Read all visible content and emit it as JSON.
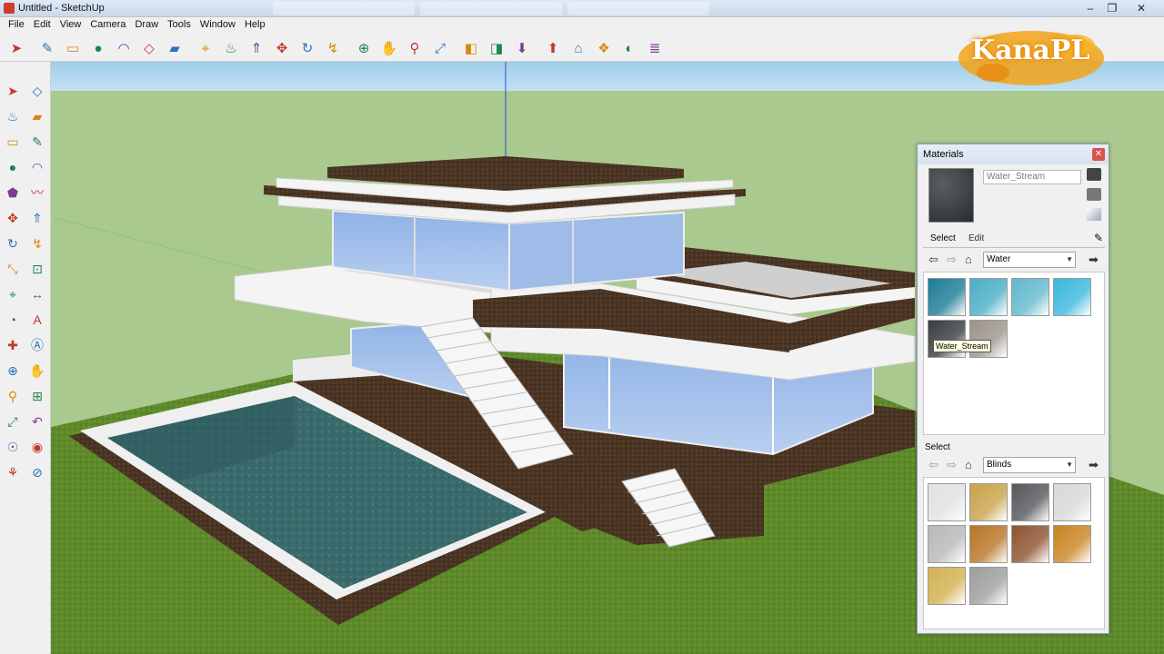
{
  "window": {
    "title": "Untitled - SketchUp"
  },
  "menu": [
    "File",
    "Edit",
    "View",
    "Camera",
    "Draw",
    "Tools",
    "Window",
    "Help"
  ],
  "toolbar_icons": [
    "select-icon",
    "pencil-icon",
    "rectangle-icon",
    "circle-icon",
    "arc-icon",
    "make-component-icon",
    "eraser-icon",
    "tape-measure-icon",
    "paint-bucket-icon",
    "push-pull-icon",
    "move-icon",
    "rotate-icon",
    "follow-me-icon",
    "orbit-icon",
    "pan-icon",
    "zoom-icon",
    "zoom-extents-icon",
    "previous-view-icon",
    "next-view-icon",
    "get-models-icon",
    "share-model-icon",
    "warehouse-icon",
    "components-icon",
    "styles-icon",
    "layers-icon"
  ],
  "left_tool_icons": [
    [
      "select-icon",
      "make-component-icon"
    ],
    [
      "paint-bucket-icon",
      "eraser-icon"
    ],
    [
      "rectangle-icon",
      "pencil-icon"
    ],
    [
      "circle-icon",
      "arc-icon"
    ],
    [
      "polygon-icon",
      "freehand-icon"
    ],
    [
      "move-icon",
      "push-pull-icon"
    ],
    [
      "rotate-icon",
      "follow-me-icon"
    ],
    [
      "scale-icon",
      "offset-icon"
    ],
    [
      "tape-measure-icon",
      "dimension-icon"
    ],
    [
      "protractor-icon",
      "text-icon"
    ],
    [
      "axes-icon",
      "3d-text-icon"
    ],
    [
      "orbit-icon",
      "pan-icon"
    ],
    [
      "zoom-icon",
      "zoom-window-icon"
    ],
    [
      "zoom-extents-icon",
      "previous-icon"
    ],
    [
      "position-camera-icon",
      "look-around-icon"
    ],
    [
      "walk-icon",
      "section-plane-icon"
    ]
  ],
  "logo": {
    "text": "KanaPL"
  },
  "materials": {
    "title": "Materials",
    "current_material": "Water_Stream",
    "tabs": {
      "select": "Select",
      "edit": "Edit"
    },
    "top_library": "Water",
    "top_swatches": [
      {
        "name": "water-deep-blue",
        "color": "#1c7c98"
      },
      {
        "name": "water-ripple",
        "color": "#4aaec6"
      },
      {
        "name": "water-light",
        "color": "#62b8cc"
      },
      {
        "name": "water-bright",
        "color": "#3bb8dc"
      },
      {
        "name": "water-stream",
        "color": "#3a3d40"
      },
      {
        "name": "water-sand",
        "color": "#9c948a"
      }
    ],
    "tooltip": "Water_Stream",
    "bottom_label": "Select",
    "bottom_library": "Blinds",
    "bottom_swatches": [
      {
        "name": "blind-white",
        "color": "#e2e2e2"
      },
      {
        "name": "blind-gold",
        "color": "#c9a24a"
      },
      {
        "name": "blind-dark-gray",
        "color": "#55575a"
      },
      {
        "name": "blind-light-gray",
        "color": "#d8d8d8"
      },
      {
        "name": "blind-silver",
        "color": "#b8b8b8"
      },
      {
        "name": "blind-wood-orange",
        "color": "#b87424"
      },
      {
        "name": "blind-wood-red",
        "color": "#8e5330"
      },
      {
        "name": "blind-wood-amber",
        "color": "#c98421"
      },
      {
        "name": "blind-bamboo",
        "color": "#d2b150"
      },
      {
        "name": "blind-gradient-gray",
        "color": "#9e9e9e"
      }
    ]
  },
  "colors": {
    "sky": "#a8d2ec",
    "grass": "#5f8a2a",
    "soil": "#4a3424",
    "glass": "#a4c1ea",
    "pool": "#3c6c6c",
    "white": "#f4f4f4"
  }
}
